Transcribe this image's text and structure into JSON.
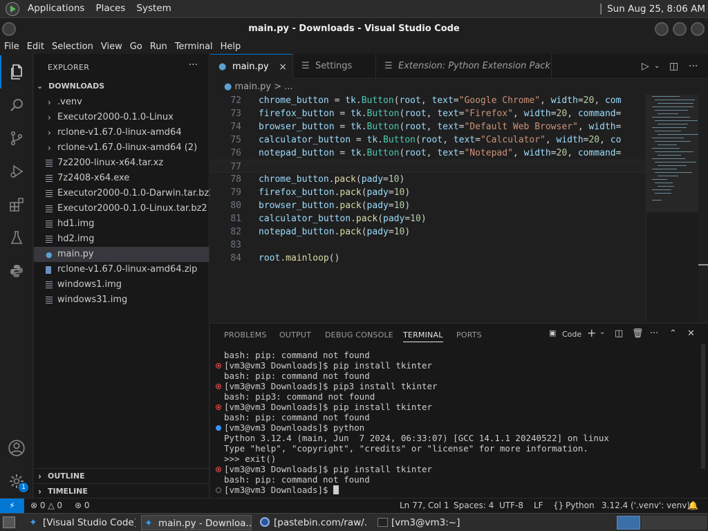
{
  "top_panel": {
    "menus": [
      "Applications",
      "Places",
      "System"
    ],
    "clock": "Sun Aug 25,  8:06 AM"
  },
  "window": {
    "title": "main.py - Downloads - Visual Studio Code"
  },
  "menubar": [
    "File",
    "Edit",
    "Selection",
    "View",
    "Go",
    "Run",
    "Terminal",
    "Help"
  ],
  "activity_bar": {
    "items": [
      "explorer-icon",
      "search-icon",
      "source-control-icon",
      "run-debug-icon",
      "extensions-icon",
      "testing-icon",
      "python-icon"
    ],
    "accounts": "account-icon",
    "manage": "gear-icon",
    "manage_badge": "1",
    "accent": "#0078d4"
  },
  "sidebar": {
    "title": "EXPLORER",
    "more": "···",
    "folder": "DOWNLOADS",
    "items": [
      {
        "label": ".venv",
        "kind": "folder"
      },
      {
        "label": "Executor2000-0.1.0-Linux",
        "kind": "folder"
      },
      {
        "label": "rclone-v1.67.0-linux-amd64",
        "kind": "folder"
      },
      {
        "label": "rclone-v1.67.0-linux-amd64 (2)",
        "kind": "folder"
      },
      {
        "label": "7z2200-linux-x64.tar.xz",
        "kind": "file"
      },
      {
        "label": "7z2408-x64.exe",
        "kind": "file"
      },
      {
        "label": "Executor2000-0.1.0-Darwin.tar.bz2",
        "kind": "file"
      },
      {
        "label": "Executor2000-0.1.0-Linux.tar.bz2",
        "kind": "file"
      },
      {
        "label": "hd1.img",
        "kind": "file"
      },
      {
        "label": "hd2.img",
        "kind": "file"
      },
      {
        "label": "main.py",
        "kind": "python",
        "selected": true
      },
      {
        "label": "rclone-v1.67.0-linux-amd64.zip",
        "kind": "zip"
      },
      {
        "label": "windows1.img",
        "kind": "file"
      },
      {
        "label": "windows31.img",
        "kind": "file"
      }
    ],
    "outline": "OUTLINE",
    "timeline": "TIMELINE"
  },
  "tabs": [
    {
      "label": "main.py",
      "close": "×",
      "active": true
    },
    {
      "label": "Settings",
      "active": false
    },
    {
      "label": "Extension: Python Extension Pack",
      "active": false
    }
  ],
  "breadcrumb": {
    "file": "main.py",
    "sep": ">",
    "rest": "..."
  },
  "editor": {
    "lines": [
      {
        "n": "72",
        "code": "chrome_button = tk.Button(root, text=\"Google Chrome\", width=20, com"
      },
      {
        "n": "73",
        "code": "firefox_button = tk.Button(root, text=\"Firefox\", width=20, command="
      },
      {
        "n": "74",
        "code": "browser_button = tk.Button(root, text=\"Default Web Browser\", width="
      },
      {
        "n": "75",
        "code": "calculator_button = tk.Button(root, text=\"Calculator\", width=20, co"
      },
      {
        "n": "76",
        "code": "notepad_button = tk.Button(root, text=\"Notepad\", width=20, command="
      },
      {
        "n": "77",
        "code": ""
      },
      {
        "n": "78",
        "code": "chrome_button.pack(pady=10)"
      },
      {
        "n": "79",
        "code": "firefox_button.pack(pady=10)"
      },
      {
        "n": "80",
        "code": "browser_button.pack(pady=10)"
      },
      {
        "n": "81",
        "code": "calculator_button.pack(pady=10)"
      },
      {
        "n": "82",
        "code": "notepad_button.pack(pady=10)"
      },
      {
        "n": "83",
        "code": ""
      },
      {
        "n": "84",
        "code": "root.mainloop()"
      }
    ],
    "current_line": "77"
  },
  "panel": {
    "tabs": [
      "PROBLEMS",
      "OUTPUT",
      "DEBUG CONSOLE",
      "TERMINAL",
      "PORTS"
    ],
    "active_tab": "TERMINAL",
    "terminal_name": "Code",
    "terminal_lines": [
      {
        "text": "bash: pip: command not found",
        "dot": ""
      },
      {
        "text": "[vm3@vm3 Downloads]$ pip install tkinter",
        "dot": "err"
      },
      {
        "text": "bash: pip: command not found",
        "dot": ""
      },
      {
        "text": "[vm3@vm3 Downloads]$ pip3 install tkinter",
        "dot": "err"
      },
      {
        "text": "bash: pip3: command not found",
        "dot": ""
      },
      {
        "text": "[vm3@vm3 Downloads]$ pip install tkinter",
        "dot": "err"
      },
      {
        "text": "bash: pip: command not found",
        "dot": ""
      },
      {
        "text": "[vm3@vm3 Downloads]$ python",
        "dot": "ok"
      },
      {
        "text": "Python 3.12.4 (main, Jun  7 2024, 06:33:07) [GCC 14.1.1 20240522] on linux",
        "dot": ""
      },
      {
        "text": "Type \"help\", \"copyright\", \"credits\" or \"license\" for more information.",
        "dot": ""
      },
      {
        "text": ">>> exit()",
        "dot": ""
      },
      {
        "text": "[vm3@vm3 Downloads]$ pip install tkinter",
        "dot": "err"
      },
      {
        "text": "bash: pip: command not found",
        "dot": ""
      },
      {
        "text": "[vm3@vm3 Downloads]$ ",
        "dot": "idle"
      }
    ]
  },
  "statusbar": {
    "remote": "⚡",
    "errors": "0",
    "warnings": "0",
    "ports": "0",
    "position": "Ln 77, Col 1",
    "spaces": "Spaces: 4",
    "encoding": "UTF-8",
    "eol": "LF",
    "language": "Python",
    "interpreter": "3.12.4 ('.venv': venv)"
  },
  "taskbar": {
    "tasks": [
      "[Visual Studio Code]",
      "main.py - Downloa...",
      "[pastebin.com/raw/...",
      "[vm3@vm3:~]"
    ],
    "active_index": 1
  }
}
